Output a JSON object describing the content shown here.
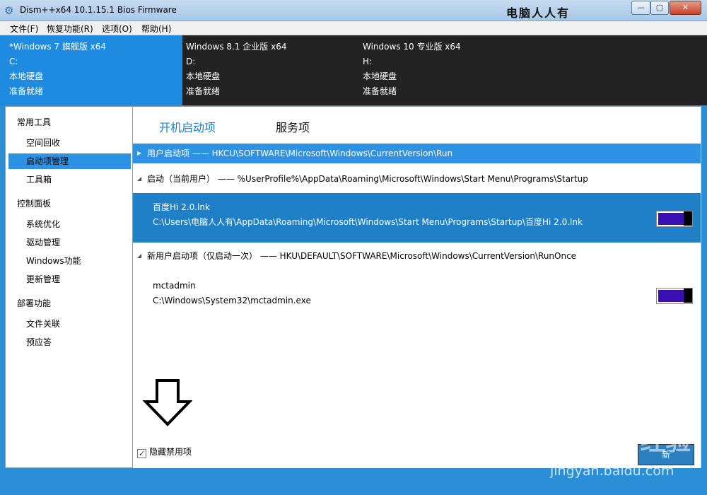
{
  "window": {
    "title": "Dism++x64 10.1.15.1 Bios Firmware",
    "watermark_title": "电脑人人有",
    "controls": {
      "minimize": "—",
      "maximize": "▢",
      "close": "✕"
    }
  },
  "menu": [
    "文件(F)",
    "恢复功能(R)",
    "选项(O)",
    "帮助(H)"
  ],
  "systems": [
    {
      "name": "*Windows 7 旗舰版 x64",
      "drive": "C:",
      "type": "本地硬盘",
      "status": "准备就绪"
    },
    {
      "name": "Windows 8.1 企业版 x64",
      "drive": "D:",
      "type": "本地硬盘",
      "status": "准备就绪"
    },
    {
      "name": "Windows 10 专业版 x64",
      "drive": "H:",
      "type": "本地硬盘",
      "status": "准备就绪"
    }
  ],
  "sidebar": {
    "groups": [
      {
        "label": "常用工具",
        "items": [
          "空间回收",
          "启动项管理",
          "工具箱"
        ]
      },
      {
        "label": "控制面板",
        "items": [
          "系统优化",
          "驱动管理",
          "Windows功能",
          "更新管理"
        ]
      },
      {
        "label": "部署功能",
        "items": [
          "文件关联",
          "预应答"
        ]
      }
    ],
    "active_item": "启动项管理"
  },
  "tabs": [
    "开机启动项",
    "服务项"
  ],
  "sections": [
    {
      "label": "用户启动项 —— HKCU\\SOFTWARE\\Microsoft\\Windows\\CurrentVersion\\Run"
    },
    {
      "label": "启动（当前用户） —— %UserProfile%\\AppData\\Roaming\\Microsoft\\Windows\\Start Menu\\Programs\\Startup"
    },
    {
      "label": "新用户启动项（仅启动一次） —— HKU\\DEFAULT\\SOFTWARE\\Microsoft\\Windows\\CurrentVersion\\RunOnce"
    }
  ],
  "entries": [
    {
      "name": "百度Hi 2.0.lnk",
      "path": "C:\\Users\\电脑人人有\\AppData\\Roaming\\Microsoft\\Windows\\Start Menu\\Programs\\Startup\\百度Hi 2.0.lnk"
    },
    {
      "name": "mctadmin",
      "path": "C:\\Windows\\System32\\mctadmin.exe"
    }
  ],
  "hide_disabled": {
    "label": "隐藏禁用项",
    "checked": true
  },
  "refresh_label": "新",
  "watermark": {
    "logo": "Bai du 经验",
    "url": "jingyan.baidu.com"
  },
  "colors": {
    "accent": "#2d92e3",
    "toggle": "#3a10b4",
    "dark_panel": "#222222"
  }
}
